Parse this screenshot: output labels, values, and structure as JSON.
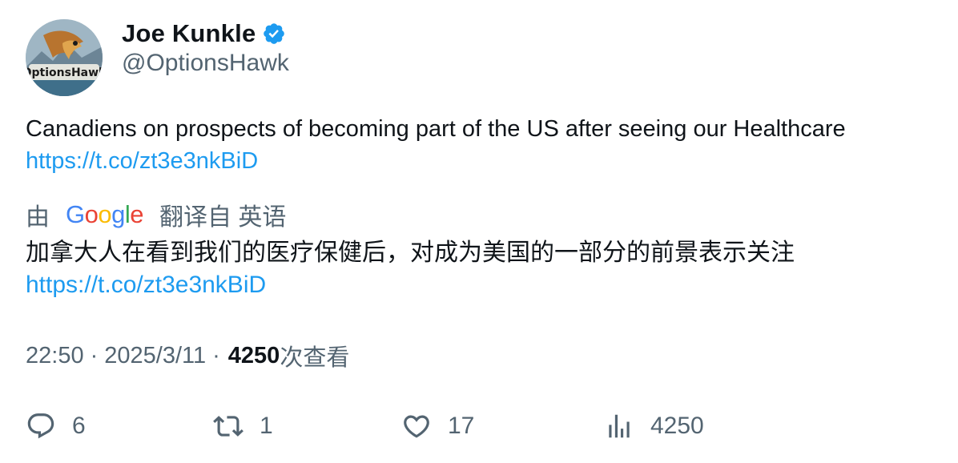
{
  "author": {
    "display_name": "Joe Kunkle",
    "handle": "@OptionsHawk",
    "avatar_text": "OptionsHawk",
    "verified_icon": "verified-badge-icon"
  },
  "tweet": {
    "text": "Canadiens on prospects of becoming part of the US after seeing our Healthcare",
    "link": "https://t.co/zt3e3nkBiD"
  },
  "translation": {
    "prefix": "由",
    "provider": "Google",
    "suffix": "翻译自 英语",
    "text": "加拿大人在看到我们的医疗保健后，对成为美国的一部分的前景表示关注",
    "link": "https://t.co/zt3e3nkBiD"
  },
  "meta": {
    "time": "22:50",
    "date": "2025/3/11",
    "views": "4250",
    "views_label": "次查看",
    "separator": "·"
  },
  "actions": {
    "replies": "6",
    "reposts": "1",
    "likes": "17",
    "views": "4250"
  },
  "colors": {
    "link": "#1d9bf0",
    "muted": "#536471",
    "text": "#0f1419",
    "verified": "#1d9bf0"
  }
}
